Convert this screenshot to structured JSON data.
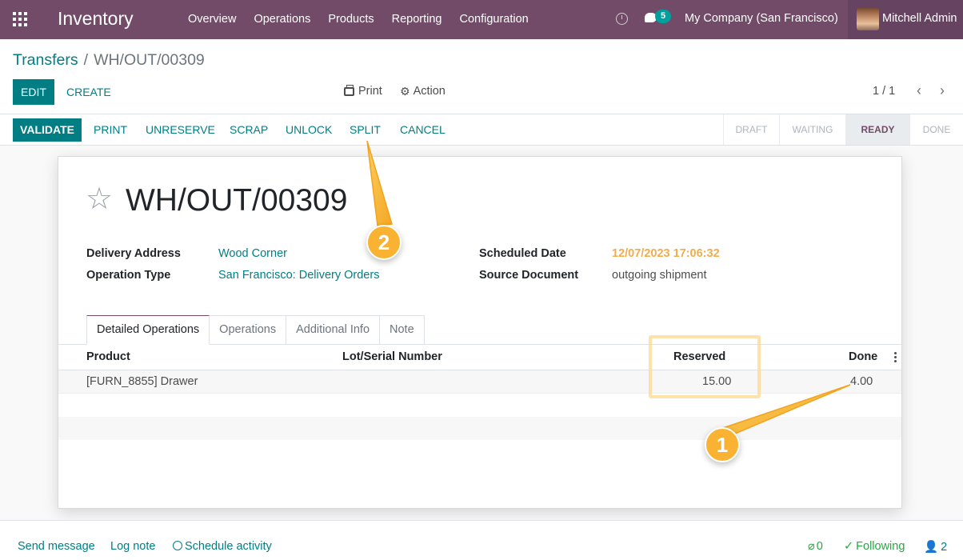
{
  "navbar": {
    "app_title": "Inventory",
    "menu": [
      "Overview",
      "Operations",
      "Products",
      "Reporting",
      "Configuration"
    ],
    "message_count": "5",
    "company": "My Company (San Francisco)",
    "user": "Mitchell Admin",
    "color": "#714b67"
  },
  "breadcrumb": {
    "parent": "Transfers",
    "separator": "/",
    "current": "WH/OUT/00309"
  },
  "toolbar": {
    "edit": "EDIT",
    "create": "CREATE",
    "print": "Print",
    "action": "Action",
    "pager": "1 / 1"
  },
  "statusbar": {
    "buttons": {
      "validate": "VALIDATE",
      "print": "PRINT",
      "unreserve": "UNRESERVE",
      "scrap": "SCRAP",
      "unlock": "UNLOCK",
      "split": "SPLIT",
      "cancel": "CANCEL"
    },
    "stages": [
      "DRAFT",
      "WAITING",
      "READY",
      "DONE"
    ],
    "active_stage": "READY"
  },
  "record": {
    "title": "WH/OUT/00309",
    "fields": {
      "delivery_address_label": "Delivery Address",
      "delivery_address": "Wood Corner",
      "operation_type_label": "Operation Type",
      "operation_type": "San Francisco: Delivery Orders",
      "scheduled_date_label": "Scheduled Date",
      "scheduled_date": "12/07/2023 17:06:32",
      "source_document_label": "Source Document",
      "source_document": "outgoing shipment"
    }
  },
  "tabs": [
    "Detailed Operations",
    "Operations",
    "Additional Info",
    "Note"
  ],
  "table": {
    "columns": {
      "product": "Product",
      "lot": "Lot/Serial Number",
      "reserved": "Reserved",
      "done": "Done"
    },
    "rows": [
      {
        "product": "[FURN_8855] Drawer",
        "lot": "",
        "reserved": "15.00",
        "done": "4.00"
      }
    ]
  },
  "annotations": {
    "callout_1": "1",
    "callout_2": "2"
  },
  "chatter": {
    "send_message": "Send message",
    "log_note": "Log note",
    "schedule_activity": "Schedule activity",
    "attachments": "0",
    "following": "Following",
    "followers": "2"
  }
}
